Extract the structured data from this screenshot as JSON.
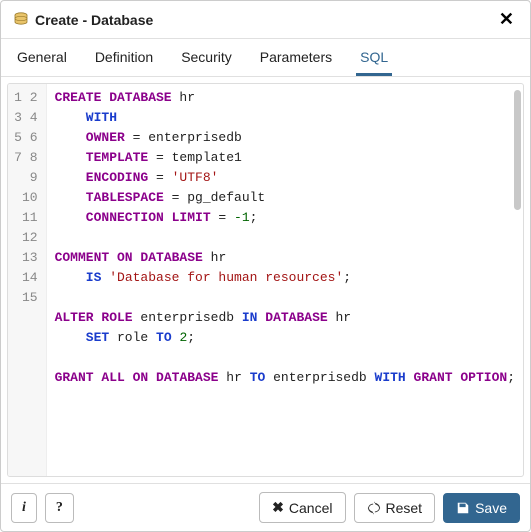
{
  "title": "Create - Database",
  "tabs": [
    {
      "label": "General",
      "active": false
    },
    {
      "label": "Definition",
      "active": false
    },
    {
      "label": "Security",
      "active": false
    },
    {
      "label": "Parameters",
      "active": false
    },
    {
      "label": "SQL",
      "active": true
    }
  ],
  "code_lines": [
    [
      [
        "kw",
        "CREATE"
      ],
      [
        "txt",
        " "
      ],
      [
        "kw",
        "DATABASE"
      ],
      [
        "txt",
        " hr"
      ]
    ],
    [
      [
        "txt",
        "    "
      ],
      [
        "kw2",
        "WITH"
      ]
    ],
    [
      [
        "txt",
        "    "
      ],
      [
        "kw",
        "OWNER"
      ],
      [
        "txt",
        " = enterprisedb"
      ]
    ],
    [
      [
        "txt",
        "    "
      ],
      [
        "kw",
        "TEMPLATE"
      ],
      [
        "txt",
        " = template1"
      ]
    ],
    [
      [
        "txt",
        "    "
      ],
      [
        "kw",
        "ENCODING"
      ],
      [
        "txt",
        " = "
      ],
      [
        "str",
        "'UTF8'"
      ]
    ],
    [
      [
        "txt",
        "    "
      ],
      [
        "kw",
        "TABLESPACE"
      ],
      [
        "txt",
        " = pg_default"
      ]
    ],
    [
      [
        "txt",
        "    "
      ],
      [
        "kw",
        "CONNECTION LIMIT"
      ],
      [
        "txt",
        " = "
      ],
      [
        "num",
        "-1"
      ],
      [
        "txt",
        ";"
      ]
    ],
    [],
    [
      [
        "kw",
        "COMMENT"
      ],
      [
        "txt",
        " "
      ],
      [
        "kw",
        "ON"
      ],
      [
        "txt",
        " "
      ],
      [
        "kw",
        "DATABASE"
      ],
      [
        "txt",
        " hr"
      ]
    ],
    [
      [
        "txt",
        "    "
      ],
      [
        "kw2",
        "IS"
      ],
      [
        "txt",
        " "
      ],
      [
        "str",
        "'Database for human resources'"
      ],
      [
        "txt",
        ";"
      ]
    ],
    [],
    [
      [
        "kw",
        "ALTER"
      ],
      [
        "txt",
        " "
      ],
      [
        "kw",
        "ROLE"
      ],
      [
        "txt",
        " enterprisedb "
      ],
      [
        "kw2",
        "IN"
      ],
      [
        "txt",
        " "
      ],
      [
        "kw",
        "DATABASE"
      ],
      [
        "txt",
        " hr"
      ]
    ],
    [
      [
        "txt",
        "    "
      ],
      [
        "kw2",
        "SET"
      ],
      [
        "txt",
        " role "
      ],
      [
        "kw2",
        "TO"
      ],
      [
        "txt",
        " "
      ],
      [
        "num",
        "2"
      ],
      [
        "txt",
        ";"
      ]
    ],
    [],
    [
      [
        "kw",
        "GRANT"
      ],
      [
        "txt",
        " "
      ],
      [
        "kw",
        "ALL"
      ],
      [
        "txt",
        " "
      ],
      [
        "kw",
        "ON"
      ],
      [
        "txt",
        " "
      ],
      [
        "kw",
        "DATABASE"
      ],
      [
        "txt",
        " hr "
      ],
      [
        "kw2",
        "TO"
      ],
      [
        "txt",
        " enterprisedb "
      ],
      [
        "kw2",
        "WITH"
      ],
      [
        "txt",
        " "
      ],
      [
        "kw",
        "GRANT"
      ],
      [
        "txt",
        " "
      ],
      [
        "kw",
        "OPTION"
      ],
      [
        "txt",
        ";"
      ]
    ]
  ],
  "footer": {
    "info_label": "i",
    "help_label": "?",
    "cancel_label": "Cancel",
    "reset_label": "Reset",
    "save_label": "Save"
  },
  "colors": {
    "accent": "#326690",
    "keyword": "#8b008b",
    "keyword2": "#1a3ccc",
    "string": "#a31515",
    "number": "#006400"
  },
  "icons": {
    "database": "database-icon",
    "close": "close-icon",
    "cancel_x": "x-icon",
    "reset": "recycle-icon",
    "save": "save-icon"
  }
}
